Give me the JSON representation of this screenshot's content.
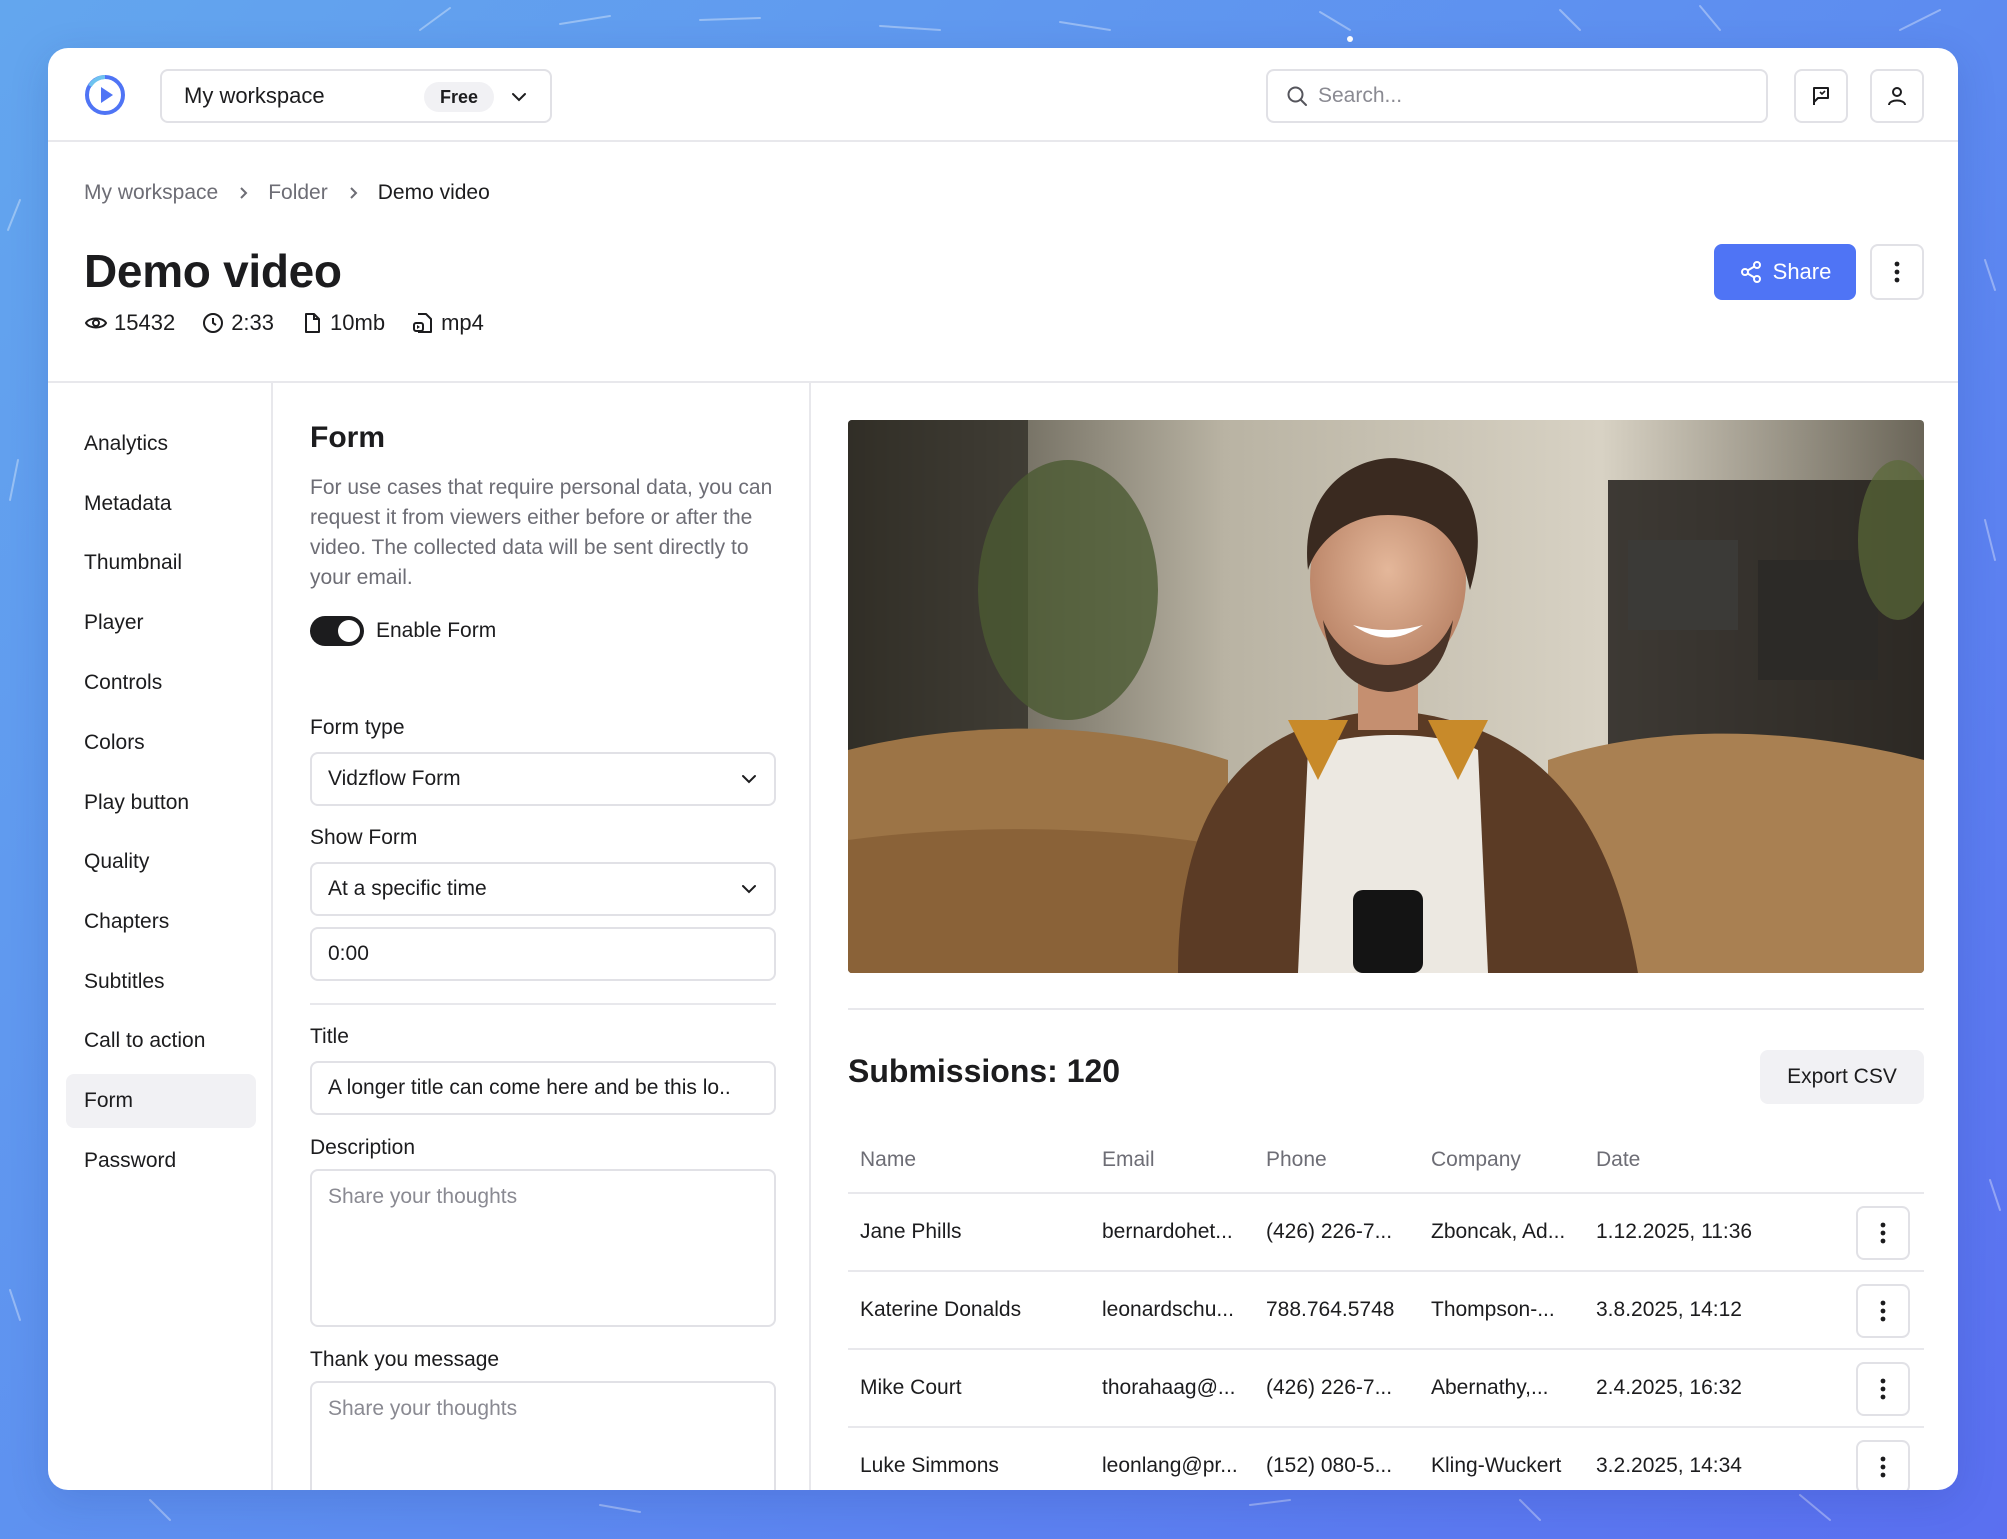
{
  "workspace": {
    "name": "My workspace",
    "plan_badge": "Free"
  },
  "search": {
    "placeholder": "Search..."
  },
  "breadcrumb": [
    "My workspace",
    "Folder",
    "Demo video"
  ],
  "video": {
    "title": "Demo video",
    "views": "15432",
    "duration": "2:33",
    "size": "10mb",
    "format": "mp4"
  },
  "actions": {
    "share_label": "Share"
  },
  "sidebar": {
    "items": [
      {
        "label": "Analytics"
      },
      {
        "label": "Metadata"
      },
      {
        "label": "Thumbnail"
      },
      {
        "label": "Player"
      },
      {
        "label": "Controls"
      },
      {
        "label": "Colors"
      },
      {
        "label": "Play button"
      },
      {
        "label": "Quality"
      },
      {
        "label": "Chapters"
      },
      {
        "label": "Subtitles"
      },
      {
        "label": "Call to action"
      },
      {
        "label": "Form",
        "active": true
      },
      {
        "label": "Password"
      }
    ]
  },
  "form": {
    "heading": "Form",
    "description": "For use cases that require personal data, you can request it from viewers either before or after the video. The collected data will be sent directly to your email.",
    "enable_label": "Enable Form",
    "enabled": true,
    "form_type_label": "Form type",
    "form_type_value": "Vidzflow Form",
    "show_form_label": "Show Form",
    "show_form_value": "At a specific time",
    "time_value": "0:00",
    "title_label": "Title",
    "title_value": "A longer title can come here and be this lo..",
    "description_label": "Description",
    "description_placeholder": "Share your thoughts",
    "thankyou_label": "Thank you message",
    "thankyou_placeholder": "Share your thoughts"
  },
  "submissions": {
    "title": "Submissions: 120",
    "export_label": "Export CSV",
    "columns": [
      "Name",
      "Email",
      "Phone",
      "Company",
      "Date"
    ],
    "rows": [
      {
        "name": "Jane Phills",
        "email": "bernardohet...",
        "phone": "(426) 226-7...",
        "company": "Zboncak, Ad...",
        "date": "1.12.2025, 11:36"
      },
      {
        "name": "Katerine Donalds",
        "email": "leonardschu...",
        "phone": "788.764.5748",
        "company": "Thompson-...",
        "date": "3.8.2025, 14:12"
      },
      {
        "name": "Mike Court",
        "email": "thorahaag@...",
        "phone": "(426) 226-7...",
        "company": "Abernathy,...",
        "date": "2.4.2025, 16:32"
      },
      {
        "name": "Luke Simmons",
        "email": "leonlang@pr...",
        "phone": "(152) 080-5...",
        "company": "Kling-Wuckert",
        "date": "3.2.2025, 14:34"
      }
    ]
  },
  "colors": {
    "accent": "#4f74f5",
    "toggle_on": "#1c1c1e",
    "background_gradient_start": "#63a6ee",
    "background_gradient_end": "#5a6ff0"
  }
}
